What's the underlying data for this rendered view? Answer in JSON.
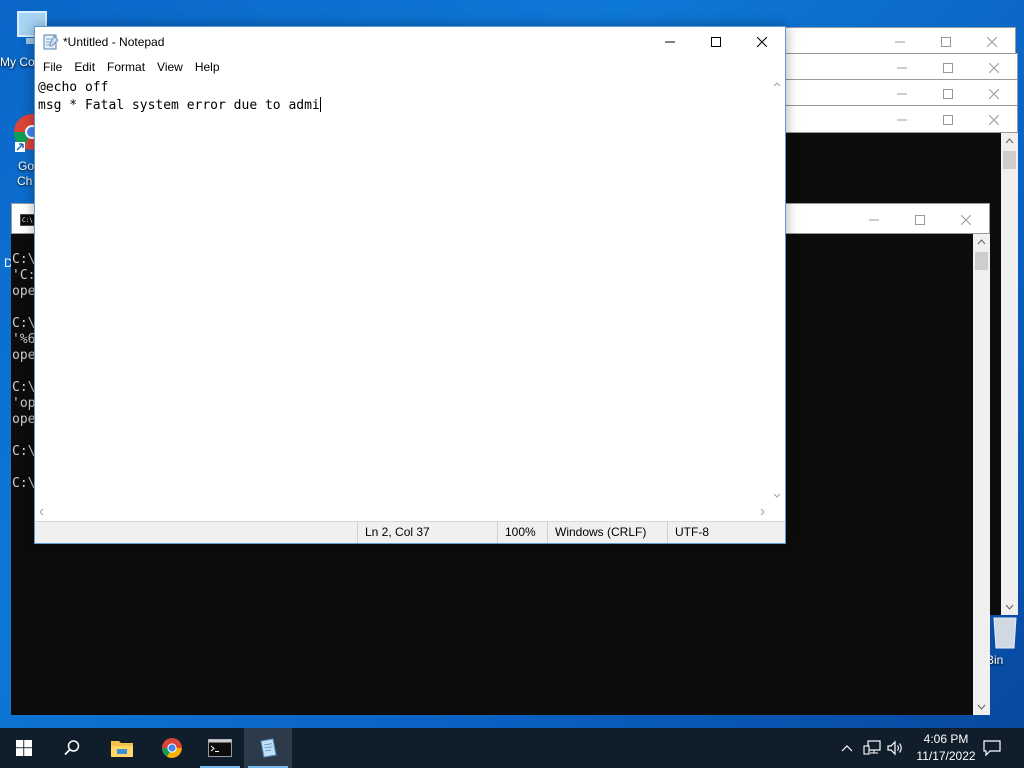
{
  "desktop": {
    "icons": [
      {
        "name": "this-pc-icon",
        "label": "My Co"
      },
      {
        "name": "google-chrome-icon",
        "label1": "Go",
        "label2": "Ch"
      },
      {
        "name": "recycle-bin-icon",
        "label": "Bin"
      }
    ],
    "stray_letter": "D"
  },
  "console_left": {
    "lines": [
      "C:\\",
      "'C:",
      "ope",
      "",
      "C:\\",
      "'%6",
      "ope",
      "",
      "C:\\",
      "'op",
      "ope",
      "",
      "C:\\",
      "",
      "C:\\"
    ]
  },
  "notepad": {
    "title": "*Untitled - Notepad",
    "menu": [
      "File",
      "Edit",
      "Format",
      "View",
      "Help"
    ],
    "lines": [
      "@echo off",
      "msg * Fatal system error due to admi"
    ],
    "status": {
      "position": "Ln 2, Col 37",
      "zoom": "100%",
      "line_ending": "Windows (CRLF)",
      "encoding": "UTF-8"
    }
  },
  "taskbar": {
    "apps": [
      "start-button",
      "search-icon",
      "file-explorer-icon",
      "google-chrome-icon",
      "command-prompt-icon",
      "notepad-icon"
    ],
    "active_app": "notepad-icon",
    "time": "4:06 PM",
    "date": "11/17/2022"
  },
  "colors": {
    "desktop_blue": "#0a66c8",
    "taskbar": "#101d2b",
    "console_bg": "#0c0c0c",
    "active_border": "#5b9bd5",
    "taskbar_accent": "#76b9ed"
  }
}
